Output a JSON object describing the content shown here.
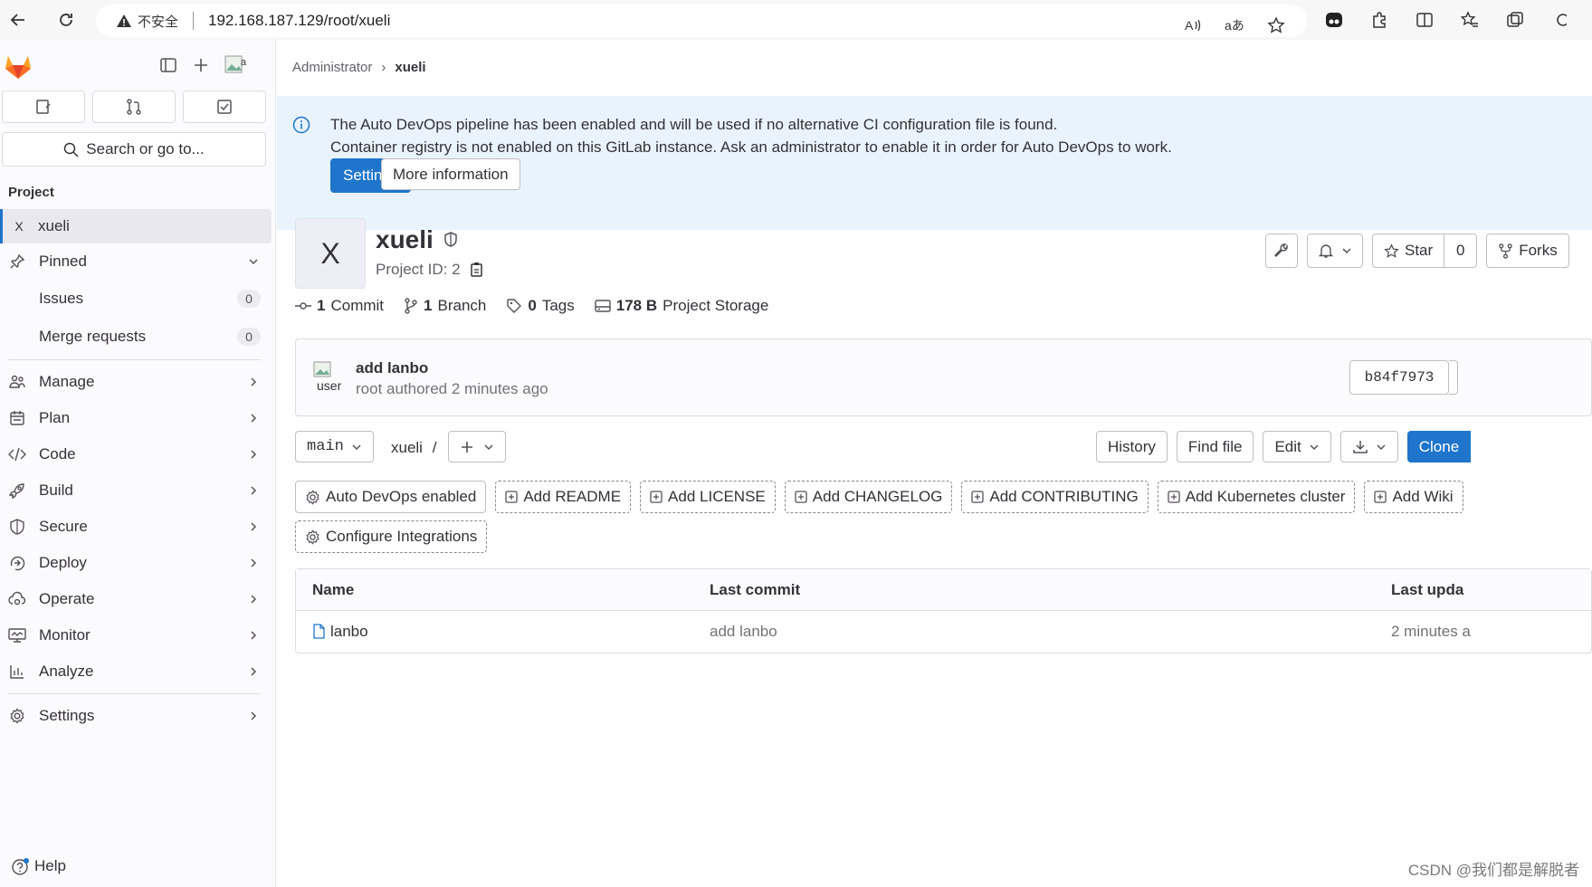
{
  "browser": {
    "security_label": "不安全",
    "url": "192.168.187.129/root/xueli"
  },
  "sidebar": {
    "search_label": "Search or go to...",
    "section_label": "Project",
    "project_letter": "X",
    "project_name": "xueli",
    "pinned_label": "Pinned",
    "pinned_items": [
      {
        "label": "Issues",
        "count": "0"
      },
      {
        "label": "Merge requests",
        "count": "0"
      }
    ],
    "nav_items": [
      {
        "label": "Manage",
        "icon": "users-icon"
      },
      {
        "label": "Plan",
        "icon": "calendar-icon"
      },
      {
        "label": "Code",
        "icon": "code-icon"
      },
      {
        "label": "Build",
        "icon": "rocket-icon"
      },
      {
        "label": "Secure",
        "icon": "shield-icon"
      },
      {
        "label": "Deploy",
        "icon": "deploy-icon"
      },
      {
        "label": "Operate",
        "icon": "cloud-gear-icon"
      },
      {
        "label": "Monitor",
        "icon": "monitor-icon"
      },
      {
        "label": "Analyze",
        "icon": "chart-icon"
      }
    ],
    "settings_label": "Settings",
    "help_label": "Help"
  },
  "breadcrumb": {
    "parent": "Administrator",
    "current": "xueli"
  },
  "alert": {
    "line1": "The Auto DevOps pipeline has been enabled and will be used if no alternative CI configuration file is found.",
    "line2": "Container registry is not enabled on this GitLab instance. Ask an administrator to enable it in order for Auto DevOps to work.",
    "primary_button": "Settings",
    "secondary_button": "More information"
  },
  "project": {
    "avatar_letter": "X",
    "name": "xueli",
    "id_label": "Project ID: 2",
    "star_label": "Star",
    "star_count": "0",
    "forks_label": "Forks"
  },
  "stats": {
    "commits_count": "1",
    "commits_label": "Commit",
    "branches_count": "1",
    "branches_label": "Branch",
    "tags_count": "0",
    "tags_label": "Tags",
    "storage_value": "178 B",
    "storage_label": "Project Storage"
  },
  "last_commit": {
    "avatar_alt": "user",
    "message": "add lanbo",
    "meta": "root authored 2 minutes ago",
    "sha": "b84f7973"
  },
  "repo": {
    "branch": "main",
    "path": "xueli",
    "path_sep": "/",
    "history": "History",
    "find_file": "Find file",
    "edit": "Edit",
    "clone": "Clone"
  },
  "shortcuts": [
    {
      "label": "Auto DevOps enabled",
      "icon": "gear-icon"
    },
    {
      "label": "Add README",
      "icon": "plus-square-icon"
    },
    {
      "label": "Add LICENSE",
      "icon": "plus-square-icon"
    },
    {
      "label": "Add CHANGELOG",
      "icon": "plus-square-icon"
    },
    {
      "label": "Add CONTRIBUTING",
      "icon": "plus-square-icon"
    },
    {
      "label": "Add Kubernetes cluster",
      "icon": "plus-square-icon"
    },
    {
      "label": "Add Wiki",
      "icon": "plus-square-icon"
    },
    {
      "label": "Configure Integrations",
      "icon": "gear-icon"
    }
  ],
  "files_table": {
    "headers": [
      "Name",
      "Last commit",
      "Last upda"
    ],
    "rows": [
      {
        "name": "lanbo",
        "last_commit": "add lanbo",
        "last_update": "2 minutes a"
      }
    ]
  },
  "watermark": "CSDN @我们都是解脱者",
  "colors": {
    "accent": "#1f75cb",
    "alert_bg": "#e9f3fc",
    "sidebar_bg": "#fbfafd"
  }
}
